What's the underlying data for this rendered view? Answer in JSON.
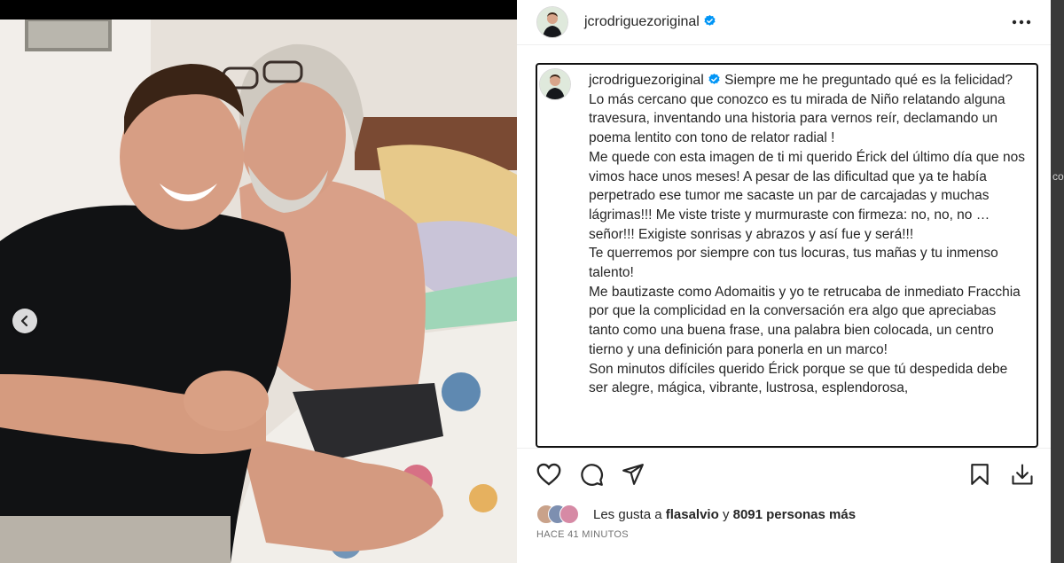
{
  "post": {
    "username": "jcrodriguezoriginal",
    "caption": "Siempre me he preguntado qué es la felicidad?\nLo más cercano que conozco es tu mirada de Niño relatando alguna travesura, inventando una historia para vernos reír, declamando un poema lentito con tono de relator radial !\nMe quede con esta imagen de ti mi querido Érick del último día que nos vimos hace unos meses! A pesar de las dificultad que ya te había perpetrado ese tumor me sacaste un par de carcajadas y muchas lágrimas!!! Me viste triste y murmuraste con firmeza: no, no, no … señor!!! Exigiste sonrisas y abrazos y así fue y será!!!\nTe querremos por siempre con tus locuras, tus mañas y tu inmenso talento!\nMe bautizaste como Adomaitis y yo te retrucaba de inmediato Fracchia por que la complicidad en la conversación era algo que apreciabas tanto como una buena frase, una palabra bien colocada, un centro tierno y una definición para ponerla en un marco!\nSon minutos difíciles querido Érick porque se que tú despedida debe ser alegre, mágica, vibrante, lustrosa, esplendorosa,",
    "likes": {
      "prefix": "Les gusta a",
      "user": "flasalvio",
      "connector": "y",
      "count": "8091 personas más"
    },
    "time_ago": "HACE 41 MINUTOS"
  },
  "page_edge_text": "co",
  "icons": {
    "verified": "verified-badge-icon",
    "more": "more-options-icon",
    "like": "heart-icon",
    "comment": "comment-icon",
    "share": "send-icon",
    "save": "bookmark-icon",
    "download": "download-icon",
    "prev": "chevron-left-icon"
  },
  "colors": {
    "verified": "#0095f6",
    "text": "#262626",
    "muted": "#737373"
  }
}
